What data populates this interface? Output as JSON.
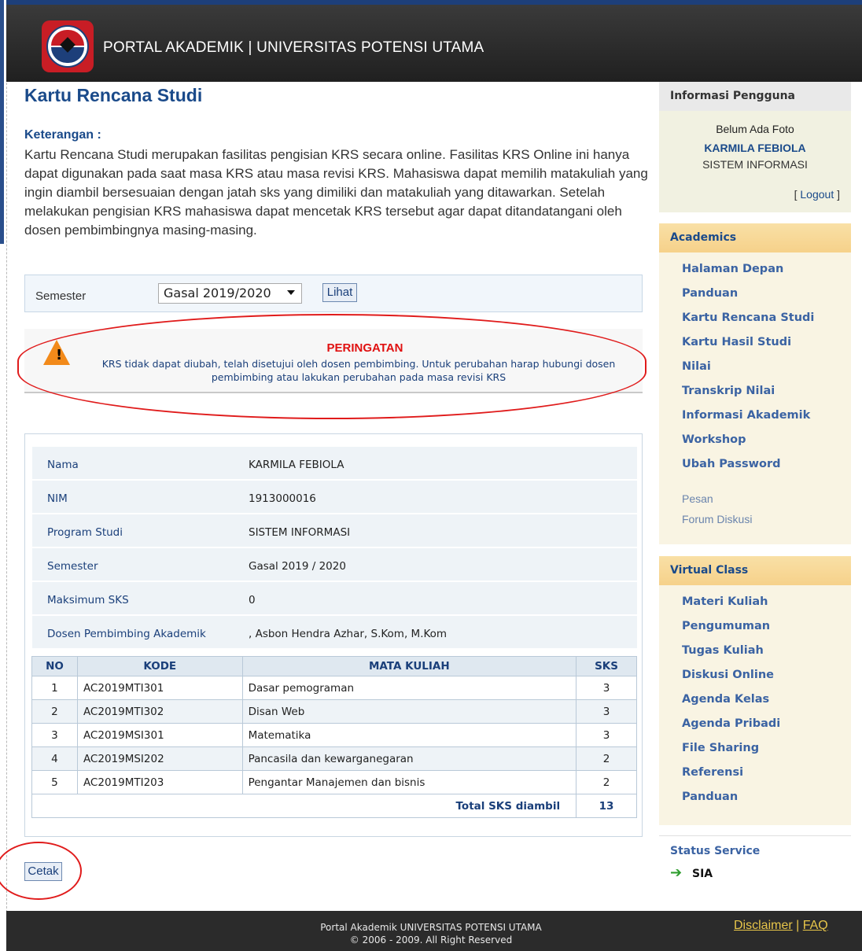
{
  "header": {
    "title": "PORTAL AKADEMIK | UNIVERSITAS POTENSI UTAMA"
  },
  "main": {
    "page_title": "Kartu Rencana Studi",
    "keterangan_label": "Keterangan :",
    "keterangan_text": "Kartu Rencana Studi merupakan fasilitas pengisian KRS secara online. Fasilitas KRS Online ini hanya dapat digunakan pada saat masa KRS atau masa revisi KRS. Mahasiswa dapat memilih matakuliah yang ingin diambil bersesuaian dengan jatah sks yang dimiliki dan matakuliah yang ditawarkan. Setelah melakukan pengisian KRS mahasiswa dapat mencetak KRS tersebut agar dapat ditandatangani oleh dosen pembimbingnya masing-masing.",
    "semester_label": "Semester",
    "semester_selected": "Gasal 2019/2020",
    "lihat_button": "Lihat",
    "warning_title": "PERINGATAN",
    "warning_text": "KRS tidak dapat diubah, telah disetujui oleh dosen pembimbing. Untuk perubahan harap hubungi dosen pembimbing atau lakukan perubahan pada masa revisi KRS",
    "info": [
      {
        "label": "Nama",
        "value": "KARMILA FEBIOLA"
      },
      {
        "label": "NIM",
        "value": "1913000016"
      },
      {
        "label": "Program Studi",
        "value": "SISTEM INFORMASI"
      },
      {
        "label": "Semester",
        "value": "Gasal 2019 / 2020"
      },
      {
        "label": "Maksimum SKS",
        "value": "0"
      },
      {
        "label": "Dosen Pembimbing Akademik",
        "value": ", Asbon Hendra Azhar, S.Kom, M.Kom"
      }
    ],
    "table": {
      "headers": [
        "NO",
        "KODE",
        "MATA KULIAH",
        "SKS"
      ],
      "rows": [
        {
          "no": "1",
          "kode": "AC2019MTI301",
          "mk": "Dasar pemograman",
          "sks": "3"
        },
        {
          "no": "2",
          "kode": "AC2019MTI302",
          "mk": "Disan Web",
          "sks": "3"
        },
        {
          "no": "3",
          "kode": "AC2019MSI301",
          "mk": "Matematika",
          "sks": "3"
        },
        {
          "no": "4",
          "kode": "AC2019MSI202",
          "mk": "Pancasila dan kewarganegaran",
          "sks": "2"
        },
        {
          "no": "5",
          "kode": "AC2019MTI203",
          "mk": "Pengantar Manajemen dan bisnis",
          "sks": "2"
        }
      ],
      "total_label": "Total SKS diambil",
      "total_value": "13"
    },
    "cetak_button": "Cetak"
  },
  "sidebar": {
    "user": {
      "header": "Informasi Pengguna",
      "foto": "Belum Ada Foto",
      "name": "KARMILA FEBIOLA",
      "prodi": "SISTEM INFORMASI",
      "logout_open": "[ ",
      "logout": "Logout",
      "logout_close": " ]"
    },
    "academics": {
      "header": "Academics",
      "items": [
        "Halaman Depan",
        "Panduan",
        "Kartu Rencana Studi",
        "Kartu Hasil Studi",
        "Nilai",
        "Transkrip Nilai",
        "Informasi Akademik",
        "Workshop",
        "Ubah Password"
      ],
      "sub_items": [
        "Pesan",
        "Forum Diskusi"
      ]
    },
    "virtual_class": {
      "header": "Virtual Class",
      "items": [
        "Materi Kuliah",
        "Pengumuman",
        "Tugas Kuliah",
        "Diskusi Online",
        "Agenda Kelas",
        "Agenda Pribadi",
        "File Sharing",
        "Referensi",
        "Panduan"
      ]
    },
    "status": {
      "header": "Status Service",
      "arrow": "➔",
      "service": "SIA"
    }
  },
  "footer": {
    "line1": "Portal Akademik UNIVERSITAS POTENSI UTAMA",
    "line2": "© 2006 - 2009. All Right Reserved",
    "disclaimer": "Disclaimer",
    "separator": " | ",
    "faq": "FAQ"
  },
  "colors": {
    "accent": "#1a4a8a",
    "warning": "#e01010",
    "annotation": "#e01b1b"
  },
  "icons": {
    "warning": "warning-triangle-icon",
    "status_arrow": "arrow-right-icon"
  }
}
